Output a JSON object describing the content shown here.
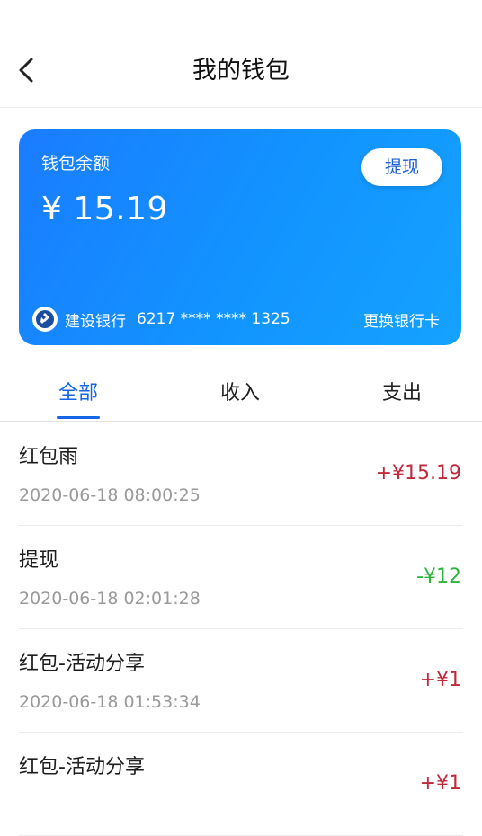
{
  "header": {
    "title": "我的钱包"
  },
  "wallet": {
    "balance_label": "钱包余额",
    "balance": "¥ 15.19",
    "withdraw_label": "提现",
    "bank_name": "建设银行",
    "card_number": "6217 **** **** 1325",
    "change_card_label": "更换银行卡"
  },
  "tabs": [
    {
      "label": "全部",
      "active": true
    },
    {
      "label": "收入",
      "active": false
    },
    {
      "label": "支出",
      "active": false
    }
  ],
  "transactions": [
    {
      "title": "红包雨",
      "time": "2020-06-18 08:00:25",
      "amount": "+¥15.19",
      "type": "income"
    },
    {
      "title": "提现",
      "time": "2020-06-18 02:01:28",
      "amount": "-¥12",
      "type": "expense"
    },
    {
      "title": "红包-活动分享",
      "time": "2020-06-18 01:53:34",
      "amount": "+¥1",
      "type": "income"
    },
    {
      "title": "红包-活动分享",
      "time": "",
      "amount": "+¥1",
      "type": "income"
    }
  ],
  "colors": {
    "accent": "#1466e6",
    "income": "#c0283b",
    "expense": "#2db43d",
    "card": "#1a7cff"
  }
}
